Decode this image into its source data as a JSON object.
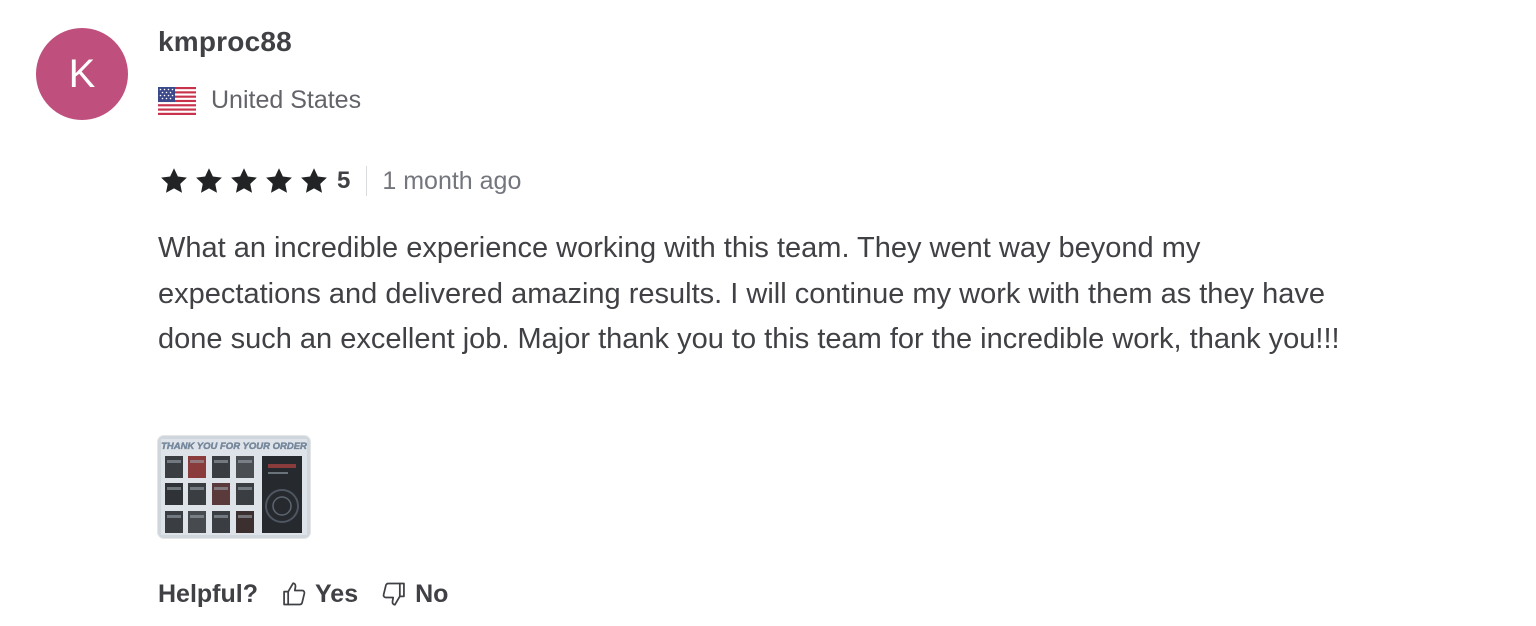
{
  "review": {
    "avatar_initial": "K",
    "avatar_color": "#bf4f7d",
    "username": "kmproc88",
    "country": {
      "name": "United States",
      "flag_icon": "us-flag-icon"
    },
    "rating": {
      "stars": 5,
      "value_label": "5",
      "star_icon": "star-icon",
      "star_color": "#222325"
    },
    "time_ago": "1 month ago",
    "text": "What an incredible experience working with this team. They went way beyond my expectations and delivered amazing results. I will continue my work with them as they have done such an excellent job. Major thank you to this team for the incredible work, thank you!!!",
    "attachment": {
      "caption": "THANK YOU FOR YOUR ORDER"
    },
    "helpful": {
      "label": "Helpful?",
      "yes_label": "Yes",
      "no_label": "No",
      "yes_icon": "thumbs-up-icon",
      "no_icon": "thumbs-down-icon"
    }
  }
}
